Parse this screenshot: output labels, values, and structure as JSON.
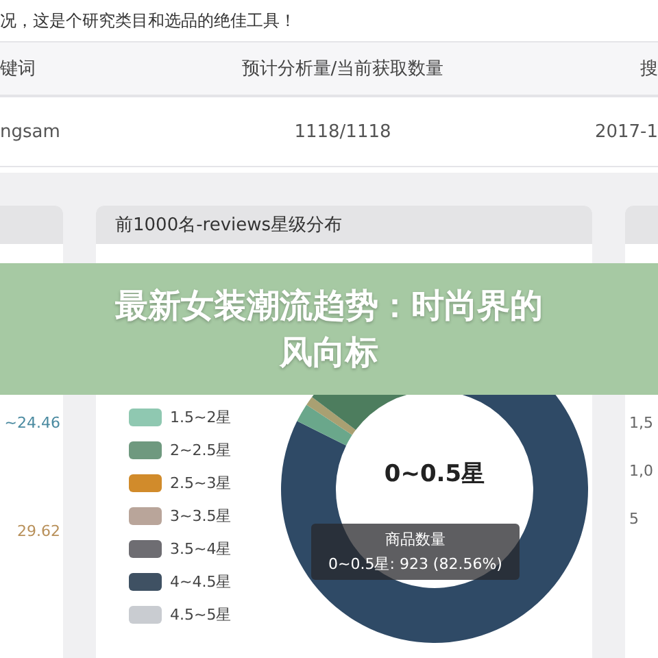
{
  "intro": "况，这是个研究类目和选品的绝佳工具！",
  "table": {
    "columns": [
      "键词",
      "预计分析量/当前获取数量",
      "搜"
    ],
    "rows": [
      [
        "ngsam",
        "1118/1118",
        "2017-1"
      ]
    ]
  },
  "left_panel": {
    "values": [
      "~24.46",
      "29.62"
    ]
  },
  "rating_panel": {
    "title": "前1000名-reviews星级分布",
    "legend": [
      {
        "label": "1.5~2星",
        "color": "#8fc8b1"
      },
      {
        "label": "2~2.5星",
        "color": "#6f997f"
      },
      {
        "label": "2.5~3星",
        "color": "#d18b2b"
      },
      {
        "label": "3~3.5星",
        "color": "#b9a59a"
      },
      {
        "label": "3.5~4星",
        "color": "#6e6d72"
      },
      {
        "label": "4~4.5星",
        "color": "#3f5163"
      },
      {
        "label": "4.5~5星",
        "color": "#c9ccd1"
      }
    ],
    "center_label": "0~0.5星",
    "tooltip": {
      "title": "商品数量",
      "text": "0~0.5星: 923 (82.56%)"
    }
  },
  "right_panel": {
    "ticks": [
      "1,5",
      "1,0",
      "5"
    ]
  },
  "banner": {
    "lines": [
      "最新女装潮流趋势：时尚界的",
      "风向标"
    ]
  }
}
